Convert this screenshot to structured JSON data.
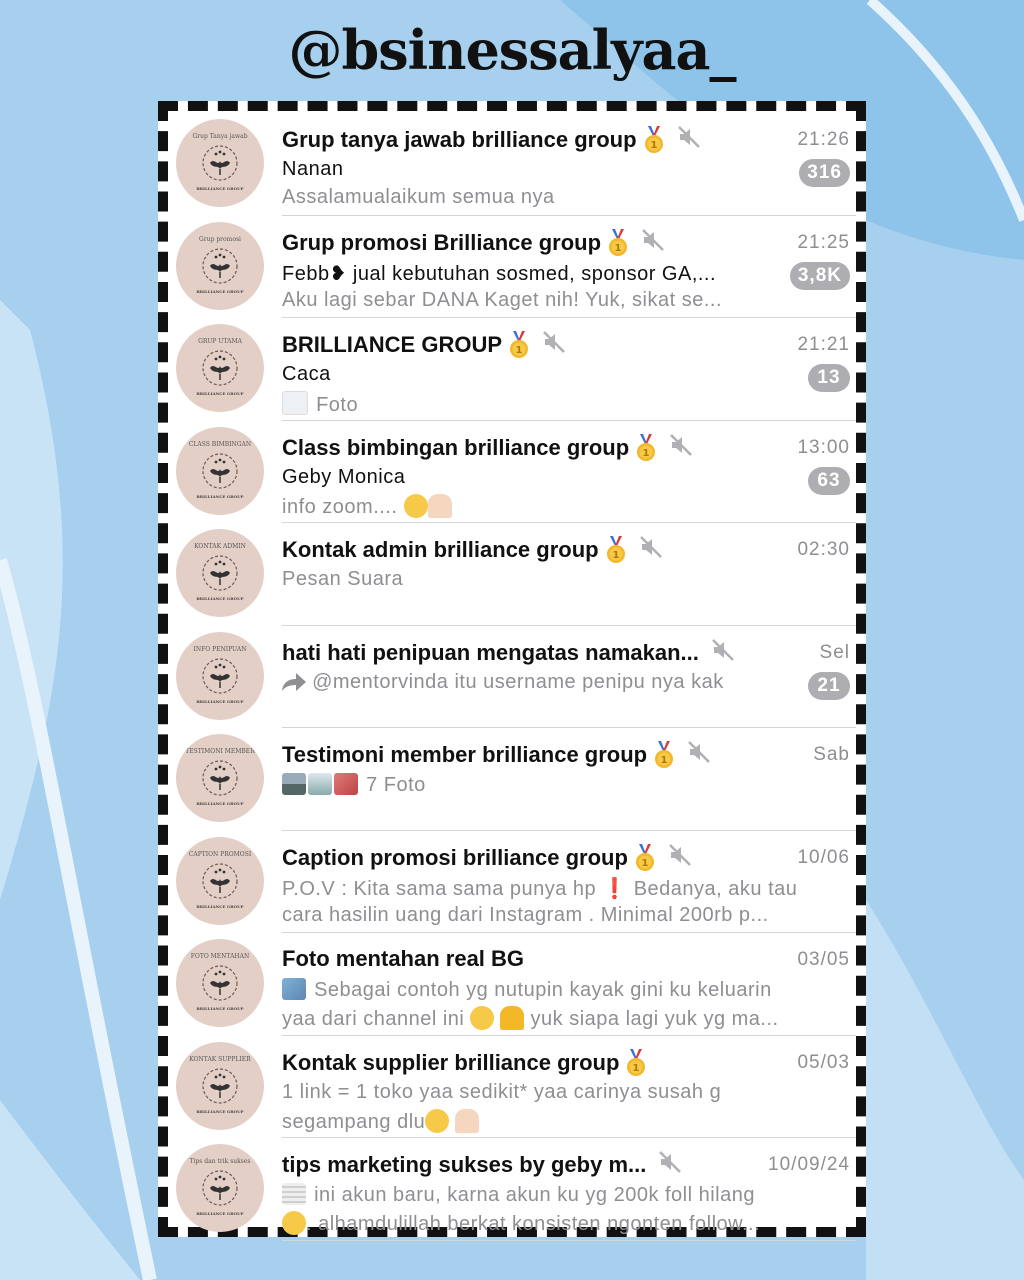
{
  "header": {
    "handle": "@bsinessalyaa_"
  },
  "chats": [
    {
      "avatar_caption": "Grup Tanya jawab",
      "title": "Grup tanya jawab brilliance group",
      "medal": true,
      "muted": true,
      "time": "21:26",
      "line1": "Nanan",
      "line2": "Assalamualaikum semua nya",
      "badge": "316"
    },
    {
      "avatar_caption": "Grup promosi",
      "title": "Grup promosi Brilliance group",
      "medal": true,
      "muted": true,
      "time": "21:25",
      "line1": "Febb❥ jual kebutuhan sosmed, sponsor GA,...",
      "line2": "Aku lagi sebar DANA Kaget nih! Yuk, sikat se...",
      "badge": "3,8K"
    },
    {
      "avatar_caption": "GRUP UTAMA",
      "title": "BRILLIANCE GROUP",
      "medal": true,
      "muted": true,
      "time": "21:21",
      "line1": "Caca",
      "line2": "Foto",
      "badge": "13"
    },
    {
      "avatar_caption": "CLASS BIMBINGAN",
      "title": "Class bimbingan brilliance group",
      "medal": true,
      "muted": true,
      "time": "13:00",
      "line1": "Geby Monica",
      "line2": "info zoom....",
      "badge": "63"
    },
    {
      "avatar_caption": "KONTAK ADMIN",
      "title": "Kontak admin brilliance group",
      "medal": true,
      "muted": true,
      "time": "02:30",
      "line1": "",
      "line2": "Pesan Suara",
      "badge": ""
    },
    {
      "avatar_caption": "INFO PENIPUAN",
      "title": "hati hati penipuan mengatas namakan...",
      "medal": false,
      "muted": true,
      "time": "Sel",
      "line1": "",
      "line2": "@mentorvinda itu username penipu nya kak",
      "badge": "21"
    },
    {
      "avatar_caption": "TESTIMONI MEMBER",
      "title": "Testimoni member brilliance group",
      "medal": true,
      "muted": true,
      "time": "Sab",
      "line1": "",
      "line2": "7 Foto",
      "badge": ""
    },
    {
      "avatar_caption": "CAPTION PROMOSI",
      "title": "Caption promosi brilliance group",
      "medal": true,
      "muted": true,
      "time": "10/06",
      "line1": "P.O.V : Kita sama sama punya hp",
      "line1b": "Bedanya, aku tau",
      "line2": "cara hasilin uang dari Instagram . Minimal 200rb p...",
      "badge": ""
    },
    {
      "avatar_caption": "FOTO MENTAHAN",
      "title": "Foto mentahan real BG",
      "medal": false,
      "muted": false,
      "time": "03/05",
      "line1": "Sebagai contoh yg nutupin kayak gini ku keluarin",
      "line2a": "yaa dari channel ini",
      "line2b": "yuk siapa lagi yuk yg ma...",
      "badge": ""
    },
    {
      "avatar_caption": "KONTAK SUPPLIER",
      "title": "Kontak supplier brilliance group",
      "medal": true,
      "muted": false,
      "time": "05/03",
      "line1": "1 link = 1 toko yaa sedikit* yaa carinya susah g",
      "line2": "segampang dlu",
      "badge": ""
    },
    {
      "avatar_caption": "Tips dan trik sukses",
      "title": "tips marketing sukses by geby m...",
      "medal": false,
      "muted": true,
      "time": "10/09/24",
      "line1": "ini akun baru, karna akun ku yg 200k foll hilang",
      "line2": ". alhamdulillah berkat konsisten ngonten follow...",
      "badge": ""
    }
  ],
  "avatar_footer": "BRILLIANCE GROUP",
  "colors": {
    "badge": "#aeaeb2",
    "muted_text": "#8e8e93",
    "background": "#a6d0ee"
  }
}
